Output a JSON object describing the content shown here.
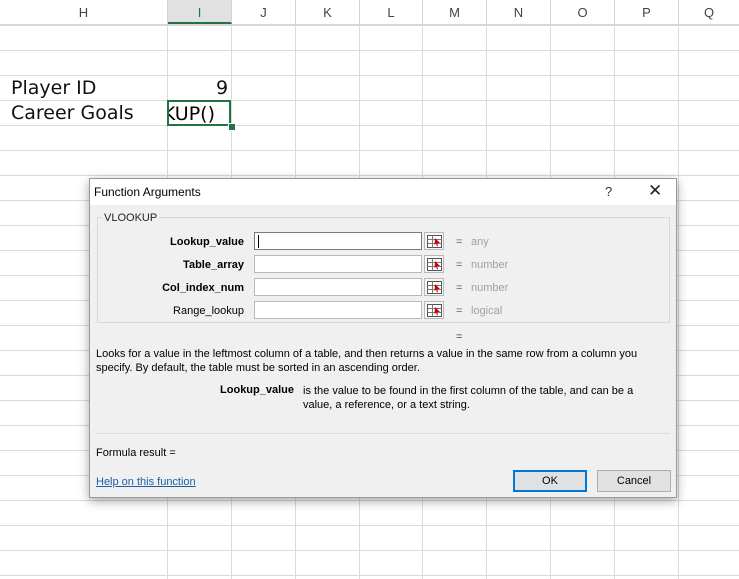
{
  "columns": [
    "H",
    "I",
    "J",
    "K",
    "L",
    "M",
    "N",
    "O",
    "P",
    "Q"
  ],
  "active_column": "I",
  "cells": {
    "player_id_label": "Player ID",
    "player_id_value": "9",
    "career_goals_label": "Career Goals",
    "active_cell_text": "KUP()"
  },
  "dialog": {
    "title": "Function Arguments",
    "help_glyph": "?",
    "close_glyph": "✕",
    "function_name": "VLOOKUP",
    "arguments": [
      {
        "label": "Lookup_value",
        "hint": "any",
        "value": ""
      },
      {
        "label": "Table_array",
        "hint": "number",
        "value": ""
      },
      {
        "label": "Col_index_num",
        "hint": "number",
        "value": ""
      },
      {
        "label": "Range_lookup",
        "hint": "logical",
        "value": ""
      }
    ],
    "equals": "=",
    "description": "Looks for a value in the leftmost column of a table, and then returns a value in the same row from a column you specify. By default, the table must be sorted in an ascending order.",
    "arg_desc_name": "Lookup_value",
    "arg_desc_text": "is the value to be found in the first column of the table, and can be a value, a reference, or a text string.",
    "formula_result_label": "Formula result =",
    "help_link": "Help on this function",
    "ok_label": "OK",
    "cancel_label": "Cancel"
  },
  "colors": {
    "accent": "#217346",
    "link": "#1a5fa6",
    "ok_border": "#0078d7"
  }
}
